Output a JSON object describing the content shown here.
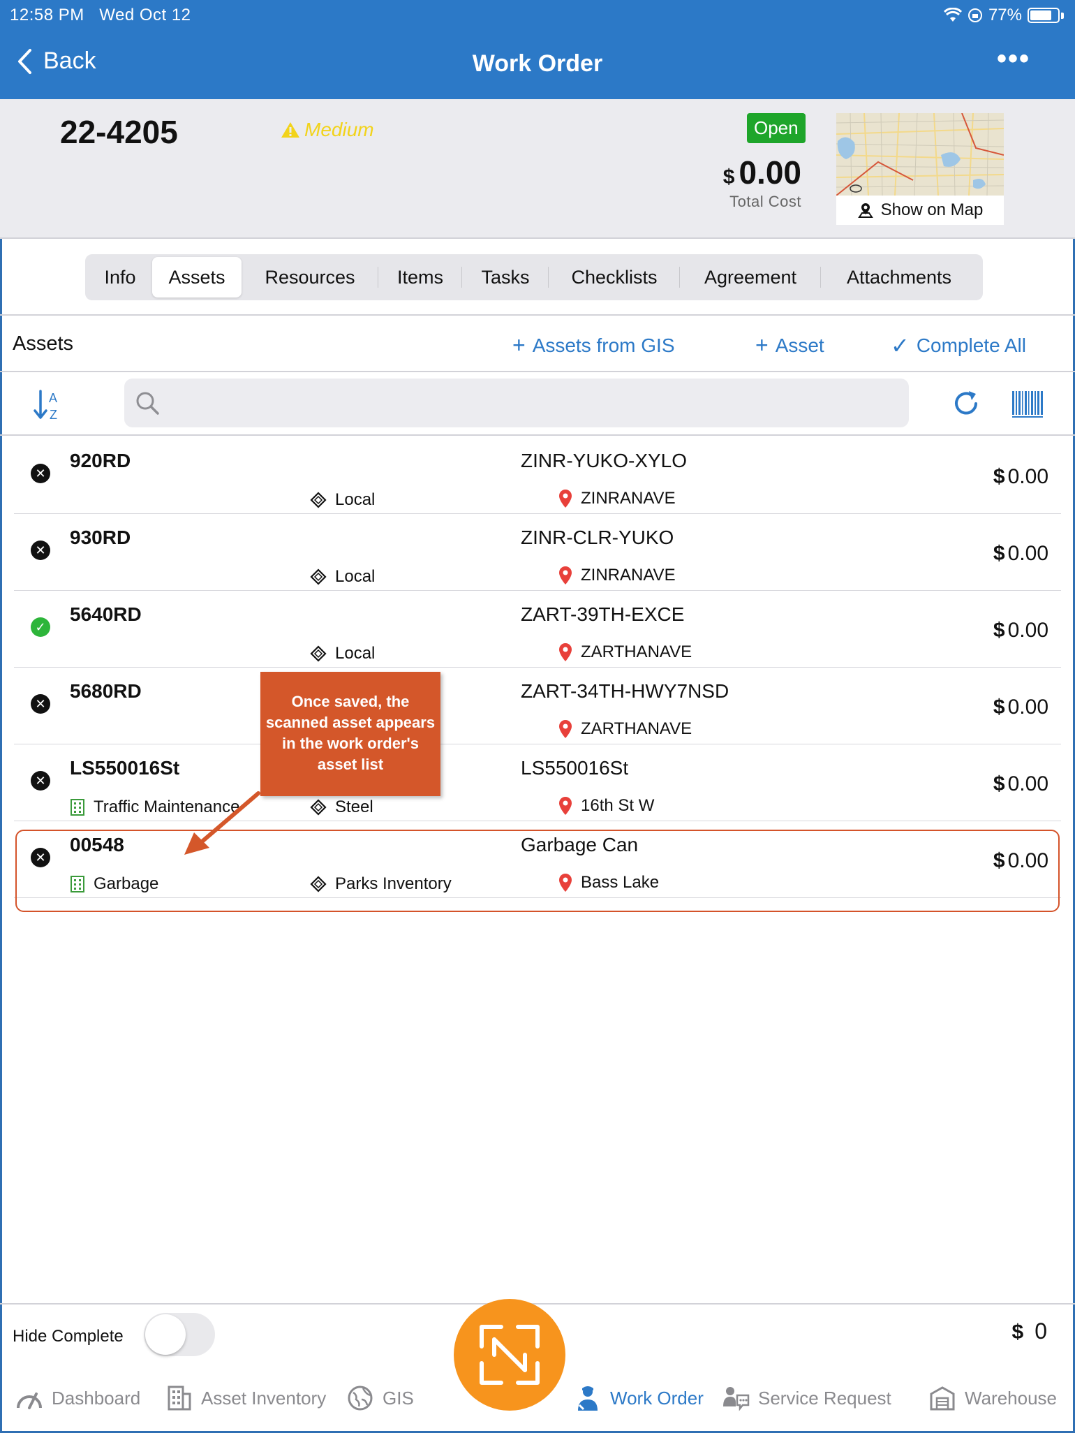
{
  "status_bar": {
    "time": "12:58 PM",
    "date": "Wed Oct 12",
    "battery": "77%"
  },
  "nav": {
    "back_label": "Back",
    "title": "Work Order",
    "more_label": "•••"
  },
  "work_order": {
    "number": "22-4205",
    "priority": "Medium",
    "status": "Open",
    "currency_symbol": "$",
    "total_cost": "0.00",
    "total_cost_label": "Total Cost",
    "show_on_map_label": "Show on Map"
  },
  "tabs": [
    {
      "label": "Info",
      "active": false
    },
    {
      "label": "Assets",
      "active": true
    },
    {
      "label": "Resources",
      "active": false
    },
    {
      "label": "Items",
      "active": false
    },
    {
      "label": "Tasks",
      "active": false
    },
    {
      "label": "Checklists",
      "active": false
    },
    {
      "label": "Agreement",
      "active": false
    },
    {
      "label": "Attachments",
      "active": false
    }
  ],
  "section": {
    "title": "Assets",
    "assets_from_gis_label": "Assets from GIS",
    "add_asset_label": "Asset",
    "complete_all_label": "Complete All"
  },
  "search": {
    "placeholder": "",
    "value": ""
  },
  "assets": [
    {
      "id": "920RD",
      "description": "ZINR-YUKO-XYLO",
      "category": "",
      "type": "Local",
      "location": "ZINRANAVE",
      "currency": "$",
      "cost": "0.00",
      "complete": false
    },
    {
      "id": "930RD",
      "description": "ZINR-CLR-YUKO",
      "category": "",
      "type": "Local",
      "location": "ZINRANAVE",
      "currency": "$",
      "cost": "0.00",
      "complete": false
    },
    {
      "id": "5640RD",
      "description": "ZART-39TH-EXCE",
      "category": "",
      "type": "Local",
      "location": "ZARTHANAVE",
      "currency": "$",
      "cost": "0.00",
      "complete": true
    },
    {
      "id": "5680RD",
      "description": "ZART-34TH-HWY7NSD",
      "category": "",
      "type": "",
      "location": "ZARTHANAVE",
      "currency": "$",
      "cost": "0.00",
      "complete": false
    },
    {
      "id": "LS550016St",
      "description": "LS550016St",
      "category": "Traffic Maintenance",
      "type": "Steel",
      "location": "16th St W",
      "currency": "$",
      "cost": "0.00",
      "complete": false
    },
    {
      "id": "00548",
      "description": "Garbage Can",
      "category": "Garbage",
      "type": "Parks Inventory",
      "location": "Bass Lake",
      "currency": "$",
      "cost": "0.00",
      "complete": false
    }
  ],
  "callout": {
    "text": "Once saved, the scanned asset appears in the work order's asset list"
  },
  "footer": {
    "hide_complete_label": "Hide Complete",
    "hide_complete_on": false,
    "currency": "$",
    "total": "0"
  },
  "tabbar": [
    {
      "label": "Dashboard",
      "icon": "dashboard-icon",
      "active": false
    },
    {
      "label": "Asset Inventory",
      "icon": "building-icon",
      "active": false
    },
    {
      "label": "GIS",
      "icon": "globe-icon",
      "active": false
    },
    {
      "label": "Work Order",
      "icon": "worker-icon",
      "active": true
    },
    {
      "label": "Service Request",
      "icon": "chat-person-icon",
      "active": false
    },
    {
      "label": "Warehouse",
      "icon": "warehouse-icon",
      "active": false
    }
  ],
  "colors": {
    "brand_blue": "#2c79c7",
    "open_green": "#1ea52a",
    "priority_yellow": "#f2d31a",
    "callout_orange": "#d4572a",
    "fab_orange": "#f7941d"
  }
}
